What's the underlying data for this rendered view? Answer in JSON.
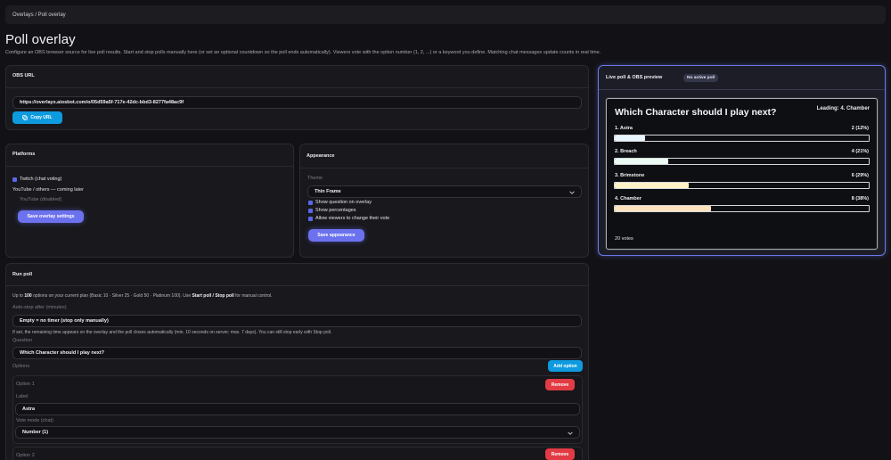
{
  "breadcrumb": "Overlays / Poll overlay",
  "title": "Poll overlay",
  "description": "Configure an OBS browser source for live poll results. Start and stop polls manually here (or set an optional countdown so the poll ends automatically). Viewers vote with the option number (1, 2, ...) or a keyword you define. Matching chat messages update counts in real time.",
  "obs": {
    "title": "OBS URL",
    "url": "https://overlays.aiosbot.com/o/05d59a5f-717e-42dc-bbd3-8277fa48ac9f",
    "copy_label": "Copy URL",
    "copy_icon": "copy-icon"
  },
  "platforms": {
    "title": "Platforms",
    "twitch_label": "Twitch (chat voting)",
    "twitch_checked": true,
    "youtube_note": "YouTube / others — coming later",
    "youtube_label": "YouTube (disabled)",
    "save_label": "Save overlay settings"
  },
  "appearance": {
    "title": "Appearance",
    "theme_label": "Theme",
    "theme_value": "Thin Frame",
    "show_question": "Show question on overlay",
    "show_percentages": "Show percentages",
    "allow_change": "Allow viewers to change their vote",
    "save_label": "Save appearance"
  },
  "run_poll": {
    "title": "Run poll",
    "plan_prefix": "Up to ",
    "plan_count": "100",
    "plan_middle": " options on your current plan (Basic 10 · Silver 25 · Gold 50 · Platinum 100). Use ",
    "plan_bold": "Start poll / Stop poll",
    "plan_suffix": " for manual control.",
    "auto_stop_label": "Auto-stop after (minutes)",
    "auto_stop_value": "Empty = no timer (stop only manually)",
    "auto_stop_help": "If set, the remaining time appears on the overlay and the poll closes automatically (min. 10 seconds on server; max. 7 days). You can still stop early with Stop poll.",
    "question_label": "Question",
    "question_value": "Which Character should I play next?",
    "options_label": "Options",
    "add_option_label": "Add option",
    "option_items": [
      {
        "heading": "Option 1",
        "remove_label": "Remove",
        "label_caption": "Label",
        "label_value": "Astra",
        "vote_mode_caption": "Vote mode (chat)",
        "vote_mode_value": "Number (1)"
      },
      {
        "heading": "Option 2",
        "remove_label": "Remove"
      }
    ]
  },
  "preview": {
    "title": "Live poll & OBS preview",
    "badge": "No active poll",
    "question": "Which Character should I play next?",
    "leading": "Leading: 4. Chamber",
    "total_votes": "20 votes",
    "options": [
      {
        "name": "1. Astra",
        "result": "2 (12%)",
        "percent": 12,
        "color": "#e9f6ff"
      },
      {
        "name": "2. Breach",
        "result": "4 (21%)",
        "percent": 21,
        "color": "#e9fbf2"
      },
      {
        "name": "3. Brimstone",
        "result": "6 (29%)",
        "percent": 29,
        "color": "#fdf3c6"
      },
      {
        "name": "4. Chamber",
        "result": "8 (38%)",
        "percent": 38,
        "color": "#fde3bd"
      }
    ]
  }
}
